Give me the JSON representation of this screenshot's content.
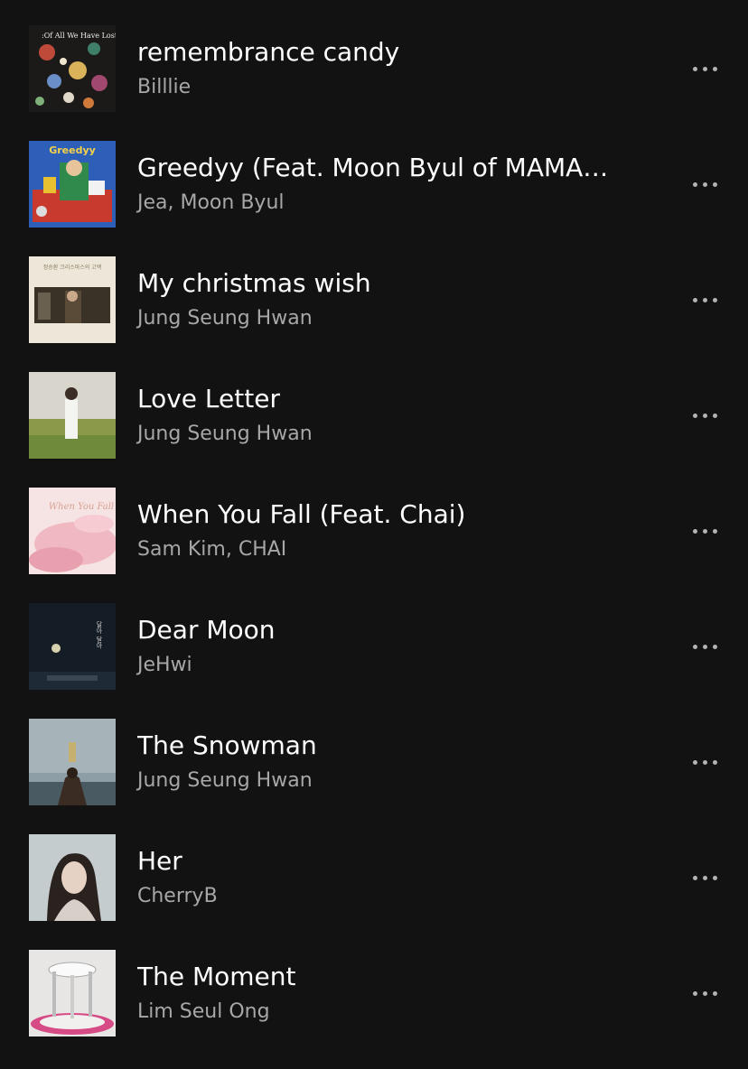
{
  "colors": {
    "background": "#121212",
    "title": "#ffffff",
    "subtitle": "#a7a7a7",
    "icon": "#b3b3b3"
  },
  "tracks": [
    {
      "title": "remembrance candy",
      "artist": "Billlie",
      "cover_text": ":Of All We Have Lost"
    },
    {
      "title": "Greedyy (Feat. Moon Byul of MAMA…",
      "artist": "Jea, Moon Byul",
      "cover_text": "Greedyy"
    },
    {
      "title": "My christmas wish",
      "artist": "Jung Seung Hwan",
      "cover_text": "정승환 크리스마스의 고백"
    },
    {
      "title": "Love Letter",
      "artist": "Jung Seung Hwan",
      "cover_text": ""
    },
    {
      "title": "When You Fall (Feat. Chai)",
      "artist": "Sam Kim, CHAI",
      "cover_text": "When You Fall"
    },
    {
      "title": "Dear Moon",
      "artist": "JeHwi",
      "cover_text": "달아 달아"
    },
    {
      "title": "The Snowman",
      "artist": "Jung Seung Hwan",
      "cover_text": ""
    },
    {
      "title": "Her",
      "artist": "CherryB",
      "cover_text": ""
    },
    {
      "title": "The Moment",
      "artist": "Lim Seul Ong",
      "cover_text": ""
    }
  ]
}
